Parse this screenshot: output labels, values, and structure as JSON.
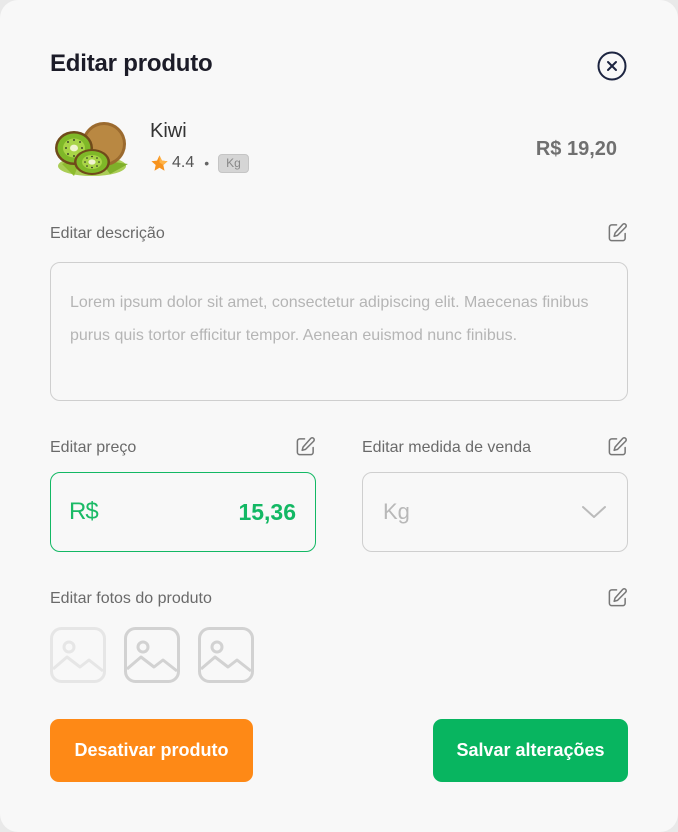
{
  "modal": {
    "title": "Editar produto",
    "close_icon": "close-circle-icon"
  },
  "product": {
    "name": "Kiwi",
    "rating": "4.4",
    "separator": "•",
    "unit_badge": "Kg",
    "price": "R$ 19,20",
    "image_icon": "kiwi-image"
  },
  "description": {
    "label": "Editar descrição",
    "placeholder": "Lorem ipsum dolor sit amet, consectetur adipiscing elit. Maecenas finibus purus quis tortor efficitur tempor. Aenean euismod nunc finibus."
  },
  "price_field": {
    "label": "Editar preço",
    "currency": "R$",
    "value": "15,36"
  },
  "unit_field": {
    "label": "Editar medida de venda",
    "selected": "Kg"
  },
  "photos": {
    "label": "Editar fotos do produto",
    "slots": 3
  },
  "actions": {
    "disable_label": "Desativar produto",
    "save_label": "Salvar alterações"
  },
  "colors": {
    "accent_green": "#13b864",
    "accent_orange": "#fe8916",
    "title_text": "#1c1c28"
  }
}
